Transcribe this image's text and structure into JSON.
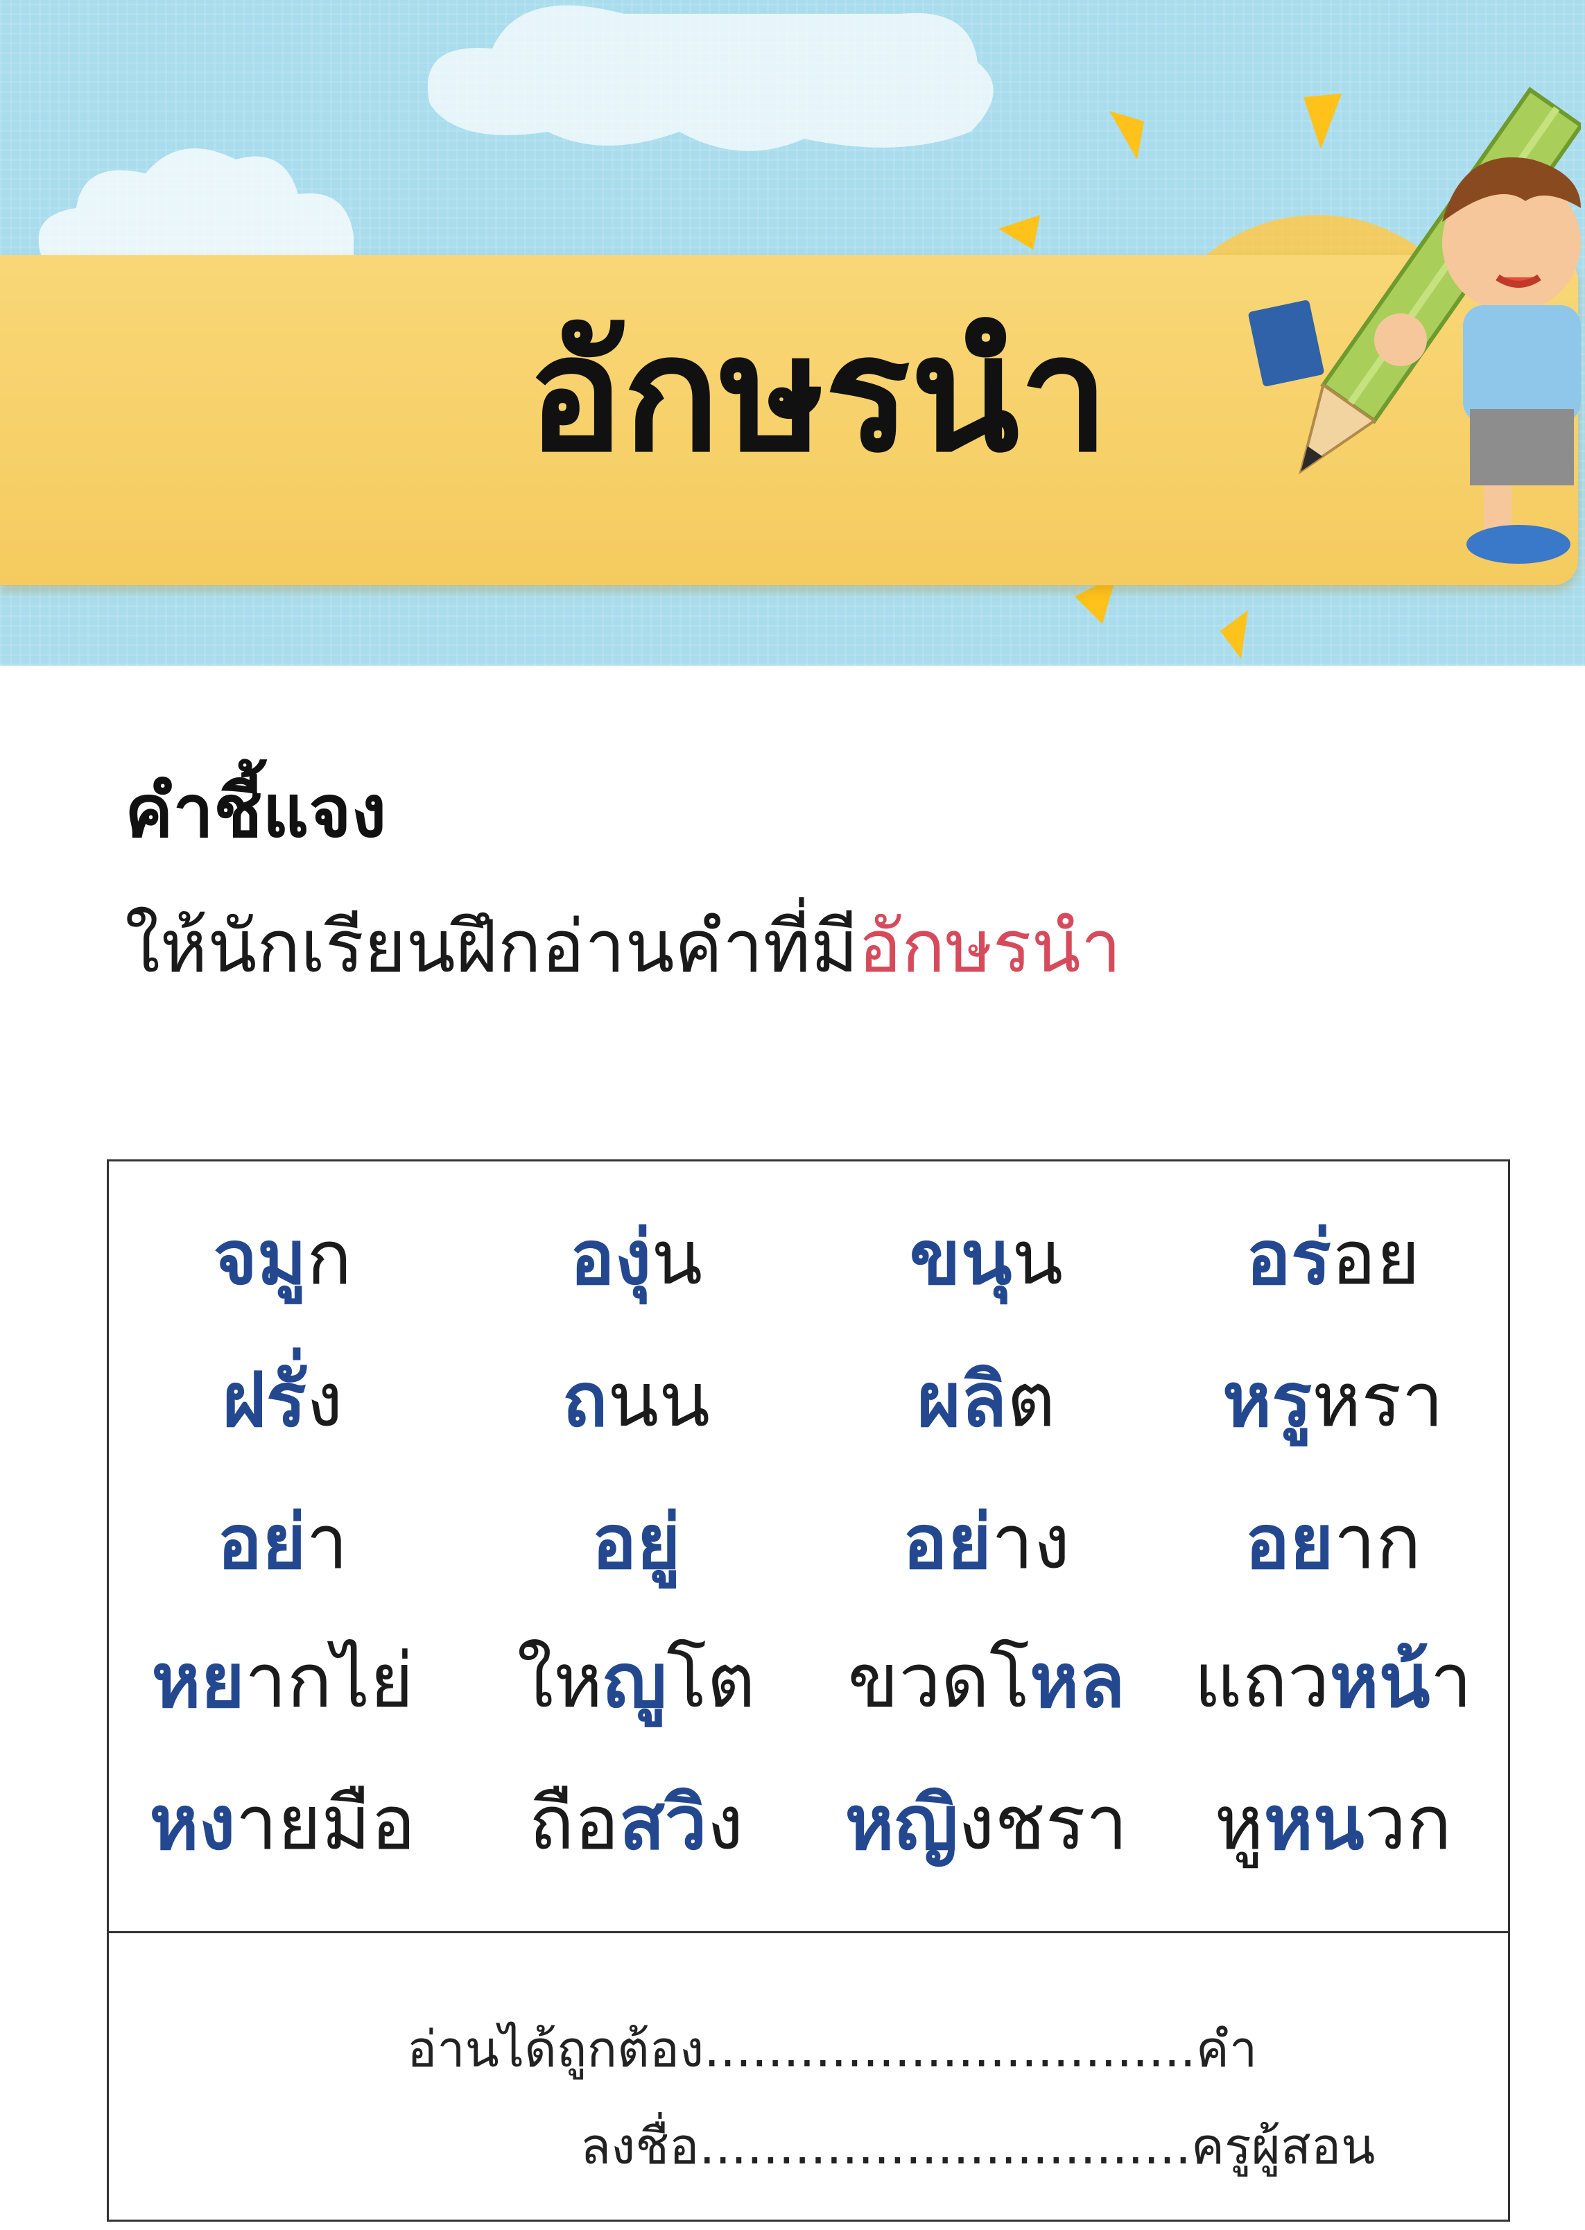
{
  "title": "อักษรนำ",
  "instruction": {
    "heading": "คำชี้แจง",
    "text_before": "ให้นักเรียนฝึกอ่านคำที่มี",
    "text_highlight": "อักษรนำ"
  },
  "colors": {
    "sky": "#a9dcec",
    "title_band": "#f7d16a",
    "highlight_red": "#d64b5c",
    "word_blue": "#23488f"
  },
  "words": [
    [
      {
        "hl": "จมู",
        "rest": "ก"
      },
      {
        "hl": "องุ่",
        "rest": "น"
      },
      {
        "hl": "ขนุ",
        "rest": "น"
      },
      {
        "hl": "อร่",
        "rest": "อย"
      }
    ],
    [
      {
        "hl": "ฝรั่",
        "rest": "ง"
      },
      {
        "hl": "ถ",
        "rest": "นน"
      },
      {
        "hl": "ผลิ",
        "rest": "ต"
      },
      {
        "hl": "หรู",
        "rest": "หรา"
      }
    ],
    [
      {
        "hl": "อย่",
        "rest": "า"
      },
      {
        "hl": "อยู่",
        "rest": ""
      },
      {
        "hl": "อย่",
        "rest": "าง"
      },
      {
        "hl": "อย",
        "rest": "าก"
      }
    ],
    [
      {
        "pre": "",
        "hl": "หย",
        "rest": "ากไย่"
      },
      {
        "pre": "ให",
        "hl": "ญู",
        "rest": "โต"
      },
      {
        "pre": "ขวดโ",
        "hl": "หล",
        "rest": ""
      },
      {
        "pre": "แถว",
        "hl": "หน้",
        "rest": "า"
      }
    ],
    [
      {
        "pre": "",
        "hl": "หง",
        "rest": "ายมือ"
      },
      {
        "pre": "ถือ",
        "hl": "สวิ",
        "rest": "ง"
      },
      {
        "pre": "",
        "hl": "หญิ",
        "rest": "งชรา"
      },
      {
        "pre": "หู",
        "hl": "หน",
        "rest": "วก"
      }
    ]
  ],
  "footer": {
    "line1_label": "อ่านได้ถูกต้อง",
    "line1_dots": "...............................",
    "line1_unit": "คำ",
    "line2_label": "ลงชื่อ",
    "line2_dots": "...............................",
    "line2_unit": "ครูผู้สอน"
  }
}
